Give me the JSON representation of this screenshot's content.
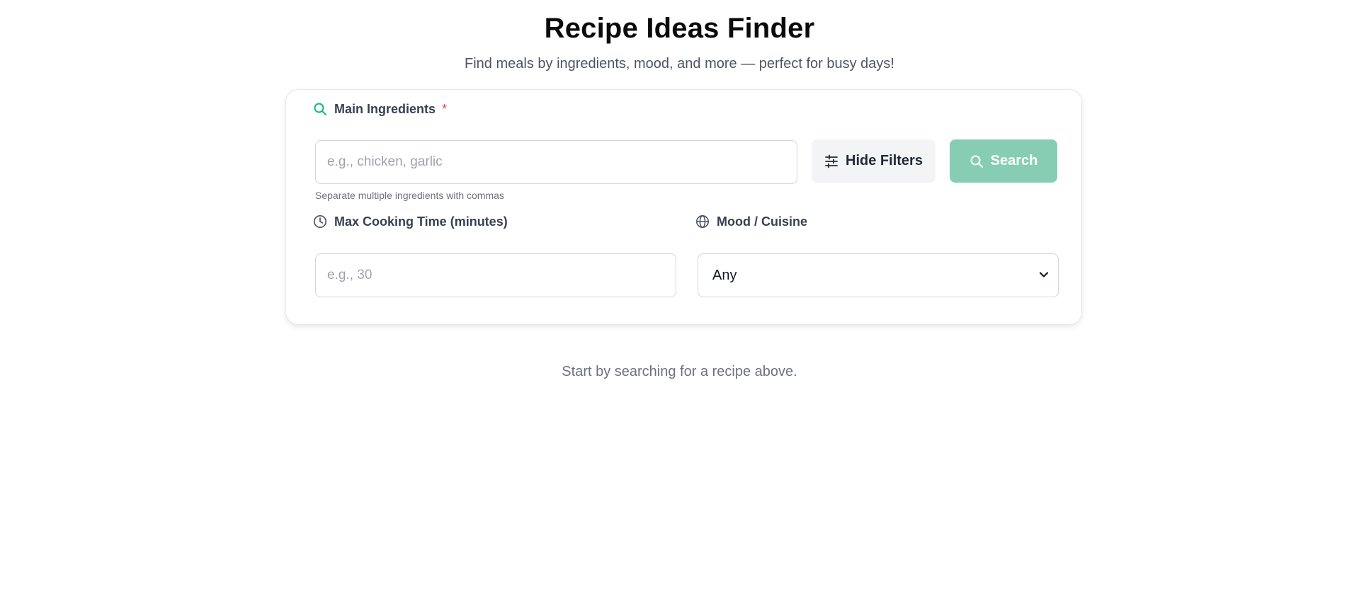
{
  "header": {
    "title": "Recipe Ideas Finder",
    "subtitle": "Find meals by ingredients, mood, and more — perfect for busy days!"
  },
  "form": {
    "ingredients": {
      "label": "Main Ingredients",
      "required_marker": "*",
      "placeholder": "e.g., chicken, garlic",
      "value": "",
      "hint": "Separate multiple ingredients with commas",
      "icon": "search-icon"
    },
    "filters_button": {
      "label": "Hide Filters",
      "icon": "sliders-icon"
    },
    "search_button": {
      "label": "Search",
      "icon": "search-icon"
    },
    "max_time": {
      "label": "Max Cooking Time (minutes)",
      "placeholder": "e.g., 30",
      "value": "",
      "icon": "clock-icon"
    },
    "mood": {
      "label": "Mood / Cuisine",
      "selected": "Any",
      "icon": "globe-icon"
    }
  },
  "results": {
    "empty_message": "Start by searching for a recipe above."
  },
  "colors": {
    "accent": "#10b981",
    "search_button_bg": "#86cdb3",
    "required": "#ef4444"
  }
}
